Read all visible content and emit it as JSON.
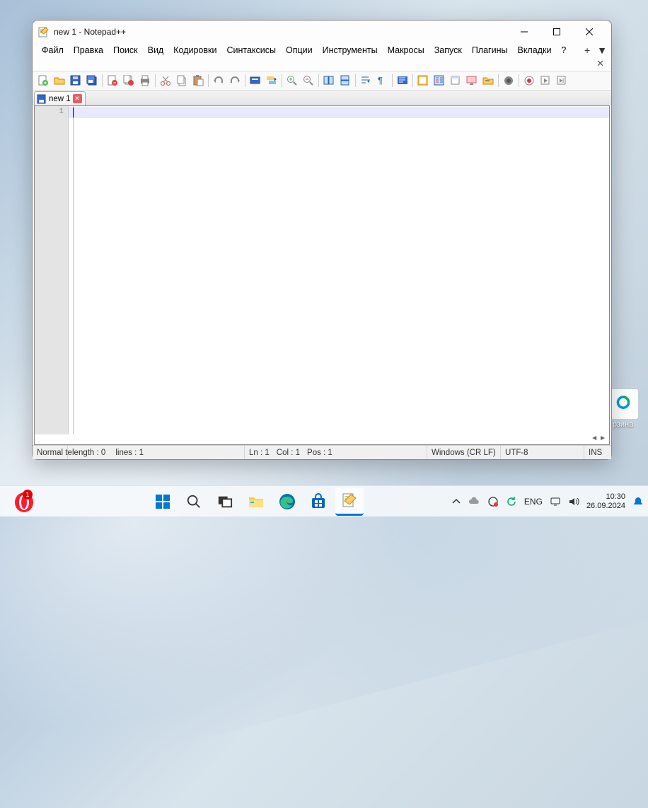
{
  "window": {
    "title": "new 1 - Notepad++",
    "minimize": "–",
    "maximize": "☐",
    "close": "✕"
  },
  "menu": {
    "items": [
      "Файл",
      "Правка",
      "Поиск",
      "Вид",
      "Кодировки",
      "Синтаксисы",
      "Опции",
      "Инструменты",
      "Макросы",
      "Запуск",
      "Плагины",
      "Вкладки",
      "?"
    ],
    "plus": "+",
    "overflow": "▼"
  },
  "toolbar": {
    "groups": [
      [
        "new-file-icon",
        "open-file-icon",
        "save-icon",
        "save-all-icon"
      ],
      [
        "print-icon",
        "close-file-icon",
        "close-all-icon"
      ],
      [
        "cut-icon",
        "copy-icon",
        "paste-icon"
      ],
      [
        "undo-icon",
        "redo-icon"
      ],
      [
        "find-icon",
        "replace-icon"
      ],
      [
        "zoom-in-icon",
        "zoom-out-icon"
      ],
      [
        "sync-v-icon",
        "sync-h-icon"
      ],
      [
        "wrap-icon",
        "whitespace-icon"
      ],
      [
        "indent-guide-icon"
      ],
      [
        "doc-map-icon",
        "func-list-icon",
        "folder-icon",
        "monitor-icon",
        "doc-switch-icon"
      ],
      [
        "record-macro-icon"
      ],
      [
        "run-macro-icon",
        "play-macro-icon",
        "playback-icon"
      ]
    ]
  },
  "tabs": {
    "items": [
      {
        "label": "new 1"
      }
    ]
  },
  "editor": {
    "line_numbers": [
      "1"
    ]
  },
  "statusbar": {
    "doc_type": "Normal te",
    "length_label": "length : 0",
    "lines_label": "lines : 1",
    "ln": "Ln : 1",
    "col": "Col : 1",
    "pos": "Pos : 1",
    "eol": "Windows (CR LF)",
    "encoding": "UTF-8",
    "mode": "INS"
  },
  "desktop": {
    "recycle_label": "рзина"
  },
  "taskbar": {
    "opera_badge": "1",
    "lang": "ENG",
    "time": "10:30",
    "date": "26.09.2024"
  }
}
